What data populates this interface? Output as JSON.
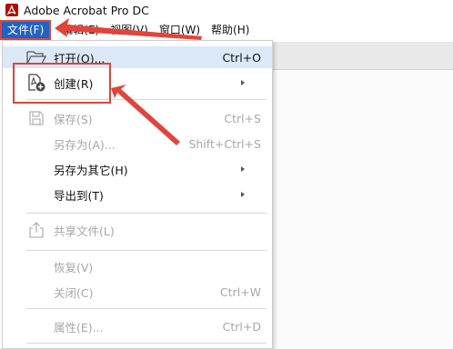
{
  "titlebar": {
    "app_title": "Adobe Acrobat Pro DC",
    "icon": "acrobat-logo-icon"
  },
  "menubar": {
    "items": [
      {
        "label": "文件(F)",
        "active": true
      },
      {
        "label": "编辑(E)"
      },
      {
        "label": "视图(V)"
      },
      {
        "label": "窗口(W)"
      },
      {
        "label": "帮助(H)"
      }
    ]
  },
  "file_menu": {
    "items": [
      {
        "label": "打开(O)...",
        "shortcut": "Ctrl+O",
        "icon": "folder-open-icon",
        "enabled": true
      },
      {
        "label": "创建(R)",
        "icon": "create-pdf-icon",
        "submenu": true,
        "enabled": true
      },
      {
        "label": "保存(S)",
        "shortcut": "Ctrl+S",
        "icon": "save-icon",
        "enabled": false
      },
      {
        "label": "另存为(A)...",
        "shortcut": "Shift+Ctrl+S",
        "enabled": false
      },
      {
        "label": "另存为其它(H)",
        "submenu": true,
        "enabled": true
      },
      {
        "label": "导出到(T)",
        "submenu": true,
        "enabled": true
      },
      {
        "label": "共享文件(L)",
        "icon": "share-icon",
        "enabled": false
      },
      {
        "label": "恢复(V)",
        "enabled": false
      },
      {
        "label": "关闭(C)",
        "shortcut": "Ctrl+W",
        "enabled": false
      },
      {
        "label": "属性(E)...",
        "shortcut": "Ctrl+D",
        "enabled": false
      }
    ]
  },
  "colors": {
    "accent": "#1f62c8",
    "annotation_red": "#e0443a",
    "hover": "#dbe8f8",
    "disabled_text": "#a7a7a7"
  }
}
